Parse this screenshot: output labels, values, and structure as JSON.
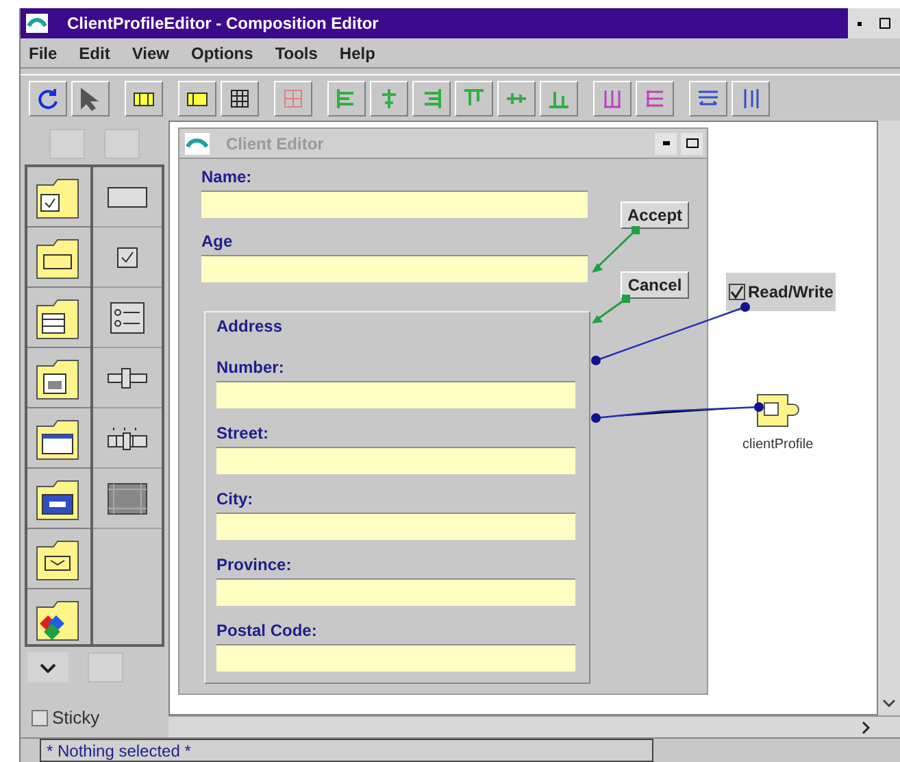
{
  "window": {
    "title": "ClientProfileEditor - Composition Editor"
  },
  "menu": [
    "File",
    "Edit",
    "View",
    "Options",
    "Tools",
    "Help"
  ],
  "palette": {
    "sticky": {
      "label": "Sticky",
      "checked": false
    }
  },
  "client_editor": {
    "title": "Client Editor",
    "fields": [
      {
        "label": "Name:"
      },
      {
        "label": "Age"
      }
    ],
    "buttons": [
      "Accept",
      "Cancel"
    ],
    "address": {
      "title": "Address",
      "fields": [
        {
          "label": "Number:"
        },
        {
          "label": "Street:"
        },
        {
          "label": "City:"
        },
        {
          "label": "Province:"
        },
        {
          "label": "Postal Code:"
        }
      ]
    }
  },
  "read_write": {
    "label": "Read/Write",
    "checked": true
  },
  "client_profile": {
    "label": "clientProfile"
  },
  "status_bar": {
    "text": "* Nothing selected *"
  }
}
